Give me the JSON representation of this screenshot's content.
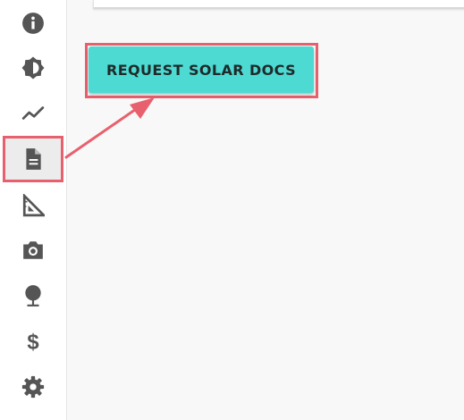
{
  "sidebar": {
    "items": [
      {
        "icon": "info-icon"
      },
      {
        "icon": "brightness-icon"
      },
      {
        "icon": "trend-line-icon"
      },
      {
        "icon": "document-icon",
        "active": true
      },
      {
        "icon": "set-square-icon"
      },
      {
        "icon": "camera-icon"
      },
      {
        "icon": "tree-icon"
      },
      {
        "icon": "dollar-icon"
      },
      {
        "icon": "gear-icon"
      }
    ]
  },
  "main": {
    "request_button_label": "REQUEST SOLAR DOCS"
  },
  "colors": {
    "accent_button": "#4ddad2",
    "annotation": "#e8606d",
    "icon": "#555555"
  }
}
